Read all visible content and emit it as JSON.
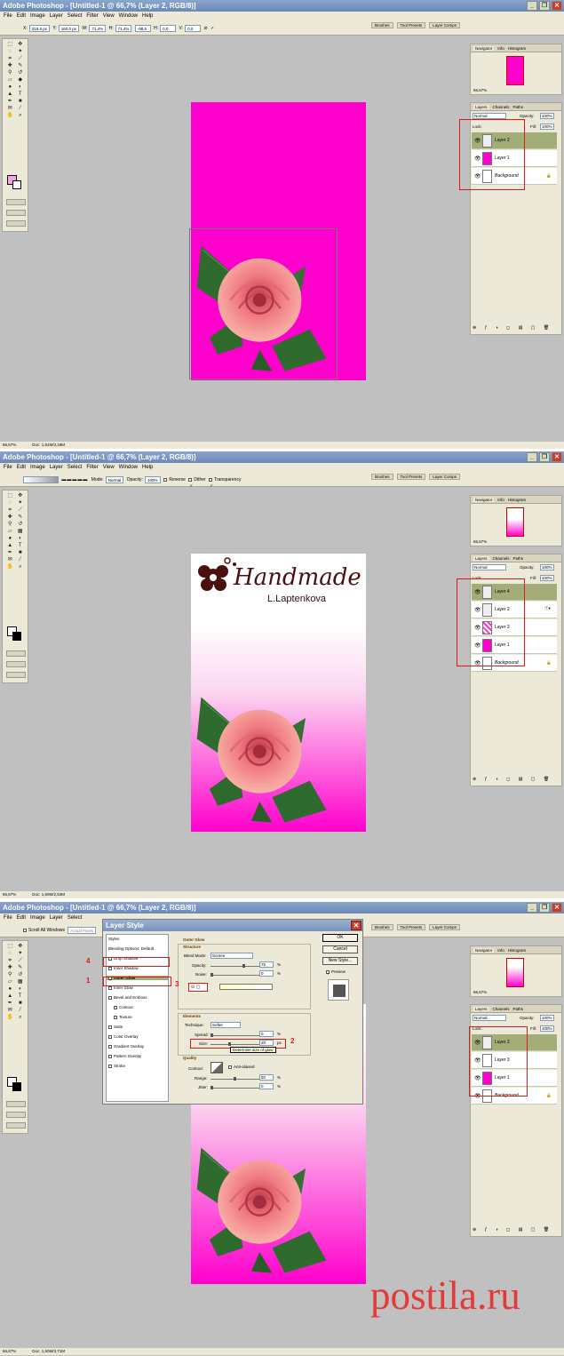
{
  "app": {
    "title": "Adobe Photoshop - [Untitled-1 @ 66,7% (Layer 2, RGB/8)]"
  },
  "menu": [
    "File",
    "Edit",
    "Image",
    "Layer",
    "Select",
    "Filter",
    "View",
    "Window",
    "Help"
  ],
  "panel_tabs": [
    "Brushes",
    "Tool Presets",
    "Layer Comps"
  ],
  "navigator": {
    "tabs": [
      "Navigator",
      "Info",
      "Histogram"
    ],
    "zoom": "66,67%"
  },
  "layers_panel": {
    "tabs": [
      "Layers",
      "Channels",
      "Paths"
    ],
    "blend_mode": "Normal",
    "opacity_label": "Opacity:",
    "opacity": "100%",
    "lock_label": "Lock:",
    "fill_label": "Fill:",
    "fill": "100%"
  },
  "screen1": {
    "options": {
      "x_label": "X:",
      "x": "219,5 px",
      "y_label": "Y:",
      "y": "160,0 px",
      "w_label": "W:",
      "w": "71,4%",
      "h_label": "H:",
      "h": "71,4%",
      "angle": "-98,6",
      "h_skew_label": "H:",
      "h_skew": "0,0",
      "v_skew_label": "V:",
      "v_skew": "0,0"
    },
    "layers": [
      "Layer 2",
      "Layer 1",
      "Background"
    ],
    "status": {
      "zoom": "66,67%",
      "doc": "Doc: 1,61M/3,18M"
    }
  },
  "screen2": {
    "options": {
      "mode_label": "Mode:",
      "mode": "Normal",
      "opacity_label": "Opacity:",
      "opacity": "100%",
      "reverse": "Reverse",
      "dither": "Dither",
      "transparency": "Transparency"
    },
    "logo": {
      "main": "Handmade",
      "sub": "L.Laptenkova"
    },
    "layers": [
      "Layer 4",
      "Layer 2",
      "Layer 3",
      "Layer 1",
      "Background"
    ],
    "status": {
      "zoom": "66,67%",
      "doc": "Doc: 1,60M/2,53M"
    }
  },
  "screen3": {
    "options": {
      "scroll_all": "Scroll All Windows",
      "actual": "Actual Pixels"
    },
    "layers": [
      "Layer 2",
      "Layer 3",
      "Layer 1",
      "Background"
    ],
    "status": {
      "zoom": "66,67%",
      "doc": "Doc: 1,60M/3,71M"
    },
    "dialog": {
      "title": "Layer Style",
      "styles_header": "Styles",
      "blending": "Blending Options: Default",
      "items": [
        "Drop Shadow",
        "Inner Shadow",
        "Outer Glow",
        "Inner Glow",
        "Bevel and Emboss",
        "Contour",
        "Texture",
        "Satin",
        "Color Overlay",
        "Gradient Overlay",
        "Pattern Overlay",
        "Stroke"
      ],
      "ok": "OK",
      "cancel": "Cancel",
      "new_style": "New Style...",
      "preview": "Preview",
      "section": "Outer Glow",
      "structure": "Structure",
      "blend_mode_label": "Blend Mode:",
      "blend_mode": "Screen",
      "opacity_label": "Opacity:",
      "opacity": "75",
      "noise_label": "Noise:",
      "noise": "0",
      "elements": "Elements",
      "technique_label": "Technique:",
      "technique": "Softer",
      "spread_label": "Spread:",
      "spread": "0",
      "size_label": "Size:",
      "size": "20",
      "tooltip": "Determine size of glow",
      "quality": "Quality",
      "contour_label": "Contour:",
      "antialiased": "Anti-aliased",
      "range_label": "Range:",
      "range": "50",
      "jitter_label": "Jitter:",
      "jitter": "0",
      "pct": "%",
      "px": "px",
      "annotations": [
        "4",
        "1",
        "3",
        "2"
      ]
    }
  },
  "watermark": "postila.ru",
  "colors": {
    "magenta": "#ff00cc",
    "highlight": "#a2ad78",
    "annotation": "#e01818"
  }
}
